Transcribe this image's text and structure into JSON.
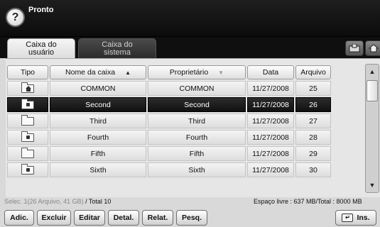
{
  "header": {
    "status": "Pronto",
    "help_symbol": "?"
  },
  "tabs": [
    {
      "label_line1": "Caixa do",
      "label_line2": "usuário",
      "active": true
    },
    {
      "label_line1": "Caixa do",
      "label_line2": "sistema",
      "active": false
    }
  ],
  "tab_buttons": {
    "box_icon": "box-icon",
    "home_icon": "home-icon"
  },
  "table": {
    "headers": {
      "tipo": "Tipo",
      "nome": "Nome da caixa",
      "proprietario": "Proprietário",
      "data": "Data",
      "arquivo": "Arquivo"
    },
    "sort_up": "▲",
    "sort_down": "▼",
    "rows": [
      {
        "icon": "shared-folder-icon",
        "nome": "COMMON",
        "proprietario": "COMMON",
        "data": "11/27/2008",
        "arquivo": "25",
        "selected": false
      },
      {
        "icon": "locked-folder-icon",
        "nome": "Second",
        "proprietario": "Second",
        "data": "11/27/2008",
        "arquivo": "26",
        "selected": true
      },
      {
        "icon": "folder-icon",
        "nome": "Third",
        "proprietario": "Third",
        "data": "11/27/2008",
        "arquivo": "27",
        "selected": false
      },
      {
        "icon": "locked-folder-icon",
        "nome": "Fourth",
        "proprietario": "Fourth",
        "data": "11/27/2008",
        "arquivo": "28",
        "selected": false
      },
      {
        "icon": "folder-icon",
        "nome": "Fifth",
        "proprietario": "Fifth",
        "data": "11/27/2008",
        "arquivo": "29",
        "selected": false
      },
      {
        "icon": "locked-folder-icon",
        "nome": "Sixth",
        "proprietario": "Sixth",
        "data": "11/27/2008",
        "arquivo": "30",
        "selected": false
      }
    ]
  },
  "scrollbar": {
    "up": "▲",
    "down": "▼"
  },
  "statusbar": {
    "selection": "Selec. 1(26 Arquivo, 41 GB)",
    "total": " / Total 10",
    "space": "Espaço livre : 637 MB/Total : 8000 MB"
  },
  "buttons": {
    "adic": "Adic.",
    "excluir": "Excluir",
    "editar": "Editar",
    "detal": "Detal.",
    "relat": "Relat.",
    "pesq": "Pesq.",
    "ins": "Ins."
  }
}
